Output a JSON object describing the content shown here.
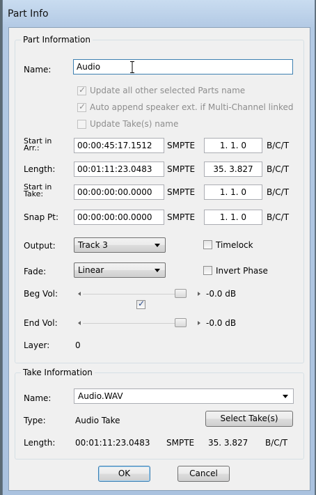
{
  "window": {
    "title": "Part Info"
  },
  "part": {
    "group_label": "Part Information",
    "name_label": "Name:",
    "name_value": "Audio",
    "options": [
      {
        "label": "Update all other selected Parts name",
        "checked": true,
        "disabled": true
      },
      {
        "label": "Auto append speaker ext. if Multi-Channel linked",
        "checked": true,
        "disabled": true
      },
      {
        "label": "Update Take(s) name",
        "checked": false,
        "disabled": true
      }
    ],
    "rows": [
      {
        "label_line1": "Start in",
        "label_line2": "Arr.:",
        "time": "00:00:45:17.1512",
        "time_unit": "SMPTE",
        "bars": "1. 1. 0",
        "bars_unit": "B/C/T"
      },
      {
        "label_line1": "Length:",
        "label_line2": "",
        "time": "00:01:11:23.0483",
        "time_unit": "SMPTE",
        "bars": "35. 3.827",
        "bars_unit": "B/C/T"
      },
      {
        "label_line1": "Start in",
        "label_line2": "Take:",
        "time": "00:00:00:00.0000",
        "time_unit": "SMPTE",
        "bars": "1. 1. 0",
        "bars_unit": "B/C/T"
      },
      {
        "label_line1": "Snap Pt:",
        "label_line2": "",
        "time": "00:00:00:00.0000",
        "time_unit": "SMPTE",
        "bars": "1. 1. 0",
        "bars_unit": "B/C/T"
      }
    ],
    "output_label": "Output:",
    "output_value": "Track 3",
    "timelock_label": "Timelock",
    "timelock_checked": false,
    "fade_label": "Fade:",
    "fade_value": "Linear",
    "invert_phase_label": "Invert Phase",
    "invert_phase_checked": false,
    "beg_vol_label": "Beg Vol:",
    "beg_vol_value": "-0.0 dB",
    "link_checked": true,
    "end_vol_label": "End Vol:",
    "end_vol_value": "-0.0 dB",
    "layer_label": "Layer:",
    "layer_value": "0"
  },
  "take": {
    "group_label": "Take Information",
    "name_label": "Name:",
    "name_value": "Audio.WAV",
    "type_label": "Type:",
    "type_value": "Audio Take",
    "select_button": "Select Take(s)",
    "length_label": "Length:",
    "length_time": "00:01:11:23.0483",
    "length_time_unit": "SMPTE",
    "length_bars": "35. 3.827",
    "length_bars_unit": "B/C/T"
  },
  "buttons": {
    "ok": "OK",
    "cancel": "Cancel"
  },
  "icons": {
    "check": "✓",
    "dropdown": "chevron-down-icon",
    "cursor": "text-cursor-icon"
  },
  "colors": {
    "title_gradient_top": "#c9dcf0",
    "dialog_bg": "#f0f0f0",
    "focus_border": "#3c7fb1"
  }
}
